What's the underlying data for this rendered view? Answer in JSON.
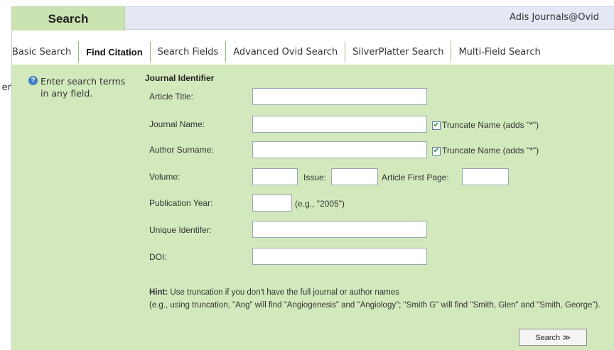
{
  "stray_text": "er",
  "header": {
    "tab_label": "Search",
    "right_label": "Adis Journals@Ovid"
  },
  "subnav": {
    "items": [
      {
        "label": "Basic Search"
      },
      {
        "label": "Find Citation"
      },
      {
        "label": "Search Fields"
      },
      {
        "label": "Advanced Ovid Search"
      },
      {
        "label": "SilverPlatter Search"
      },
      {
        "label": "Multi-Field Search"
      }
    ],
    "active": "Find Citation"
  },
  "help": {
    "icon": "question-icon",
    "text": "Enter search terms in any field."
  },
  "form": {
    "section_title": "Journal Identifier",
    "article_title": {
      "label": "Article Title:",
      "value": ""
    },
    "journal_name": {
      "label": "Journal Name:",
      "value": "",
      "truncate_label": "Truncate Name (adds \"*\")",
      "truncate_checked": true
    },
    "author_surname": {
      "label": "Author Surname:",
      "value": "",
      "truncate_label": "Truncate Name (adds \"*\")",
      "truncate_checked": true
    },
    "volume": {
      "label": "Volume:",
      "value": ""
    },
    "issue": {
      "label": "Issue:",
      "value": ""
    },
    "first_page": {
      "label": "Article First Page:",
      "value": ""
    },
    "publication_year": {
      "label": "Publication Year:",
      "value": "",
      "example": "(e.g., \"2005\")"
    },
    "unique_identifier": {
      "label": "Unique Identifer:",
      "value": ""
    },
    "doi": {
      "label": "DOI:",
      "value": ""
    }
  },
  "hint": {
    "prefix": "Hint:",
    "line1": "Use truncation if you don't have the full journal or author names",
    "line2": "(e.g., using truncation, \"Ang\" will find \"Angiogenesis\" and \"Angiology\"; \"Smith G\" will find \"Smith, Glen\" and \"Smith, George\")."
  },
  "search_button": {
    "label": "Search ≫"
  },
  "colors": {
    "content_bg": "#d3e9bd",
    "tab_bg": "#cbe3b1",
    "header_bg": "#e4e8f4"
  }
}
